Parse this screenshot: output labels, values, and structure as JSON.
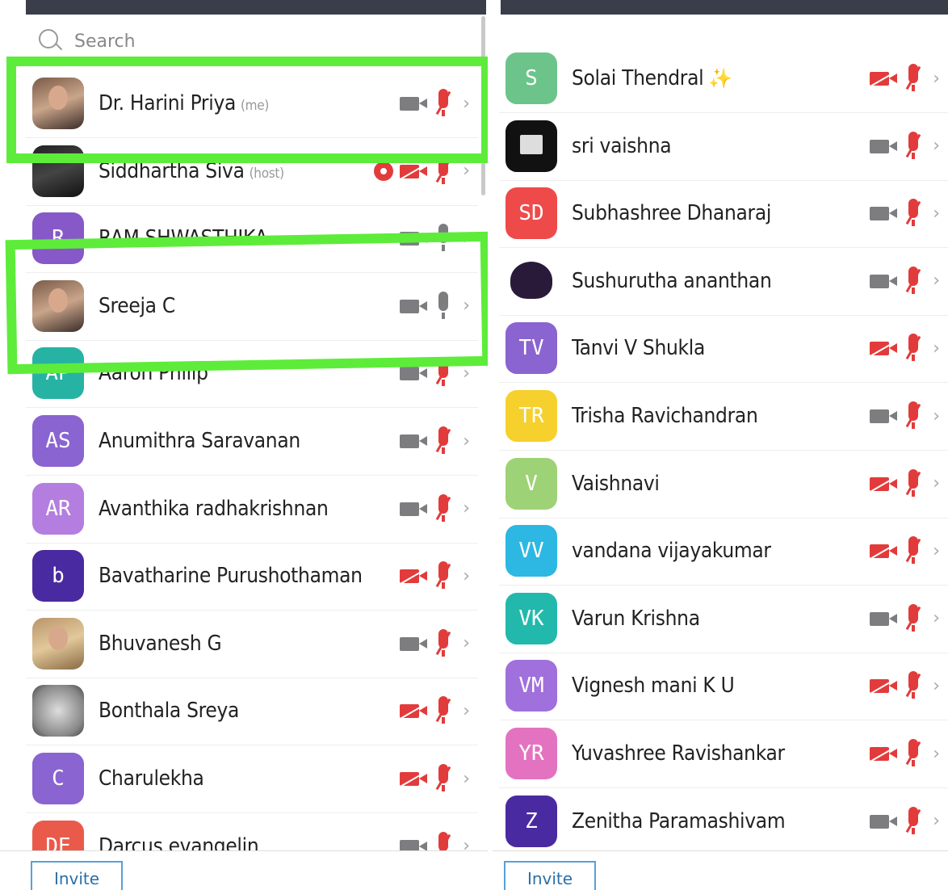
{
  "search": {
    "placeholder": "Search"
  },
  "colors": {
    "highlight": "#5eec3a",
    "muted": "#e23b3b",
    "icon_gray": "#7d7d80"
  },
  "left": [
    {
      "name": "Dr. Harini Priya",
      "tag": "(me)",
      "avatar": "photo",
      "cam": "on",
      "mic": "off"
    },
    {
      "name": "Siddhartha Siva",
      "tag": "(host)",
      "avatar": "photo",
      "cam": "off",
      "mic": "off",
      "rec": true
    },
    {
      "name": "RAM SHWASTHIKA",
      "initials": "R",
      "color": "#8658c8",
      "cam": "on",
      "mic": "on"
    },
    {
      "name": "Sreeja C",
      "avatar": "photo",
      "cam": "on",
      "mic": "on"
    },
    {
      "name": "Aaron Philip",
      "initials": "AP",
      "color": "#27b3a4",
      "cam": "on",
      "mic": "off"
    },
    {
      "name": "Anumithra Saravanan",
      "initials": "AS",
      "color": "#8a64d0",
      "cam": "on",
      "mic": "off"
    },
    {
      "name": "Avanthika radhakrishnan",
      "initials": "AR",
      "color": "#b47ee0",
      "cam": "on",
      "mic": "off"
    },
    {
      "name": "Bavatharine Purushothaman",
      "initials": "b",
      "color": "#4a2aa0",
      "cam": "off",
      "mic": "off"
    },
    {
      "name": "Bhuvanesh G",
      "avatar": "photo",
      "cam": "on",
      "mic": "off"
    },
    {
      "name": "Bonthala Sreya",
      "avatar": "photo",
      "cam": "off",
      "mic": "off"
    },
    {
      "name": "Charulekha",
      "initials": "C",
      "color": "#8a64d0",
      "cam": "off",
      "mic": "off"
    },
    {
      "name": "Darcus evangelin",
      "initials": "DE",
      "color": "#ea5a4a",
      "cam": "on",
      "mic": "off"
    }
  ],
  "right": [
    {
      "name": "Solai Thendral",
      "initials": "S",
      "color": "#6cc48a",
      "cam": "off",
      "mic": "off",
      "sparkle": "✨"
    },
    {
      "name": "sri vaishna",
      "avatar": "photo",
      "cam": "on",
      "mic": "off"
    },
    {
      "name": "Subhashree Dhanaraj",
      "initials": "SD",
      "color": "#ef4a4a",
      "cam": "on",
      "mic": "off"
    },
    {
      "name": "Sushurutha ananthan",
      "avatar": "photo",
      "cam": "on",
      "mic": "off"
    },
    {
      "name": "Tanvi V Shukla",
      "initials": "TV",
      "color": "#8a64d0",
      "cam": "off",
      "mic": "off"
    },
    {
      "name": "Trisha Ravichandran",
      "initials": "TR",
      "color": "#f6d02c",
      "cam": "on",
      "mic": "off"
    },
    {
      "name": "Vaishnavi",
      "initials": "V",
      "color": "#9ed276",
      "cam": "off",
      "mic": "off"
    },
    {
      "name": "vandana vijayakumar",
      "initials": "VV",
      "color": "#2cb8e2",
      "cam": "off",
      "mic": "off"
    },
    {
      "name": "Varun Krishna",
      "initials": "VK",
      "color": "#22b9ac",
      "cam": "on",
      "mic": "off"
    },
    {
      "name": "Vignesh mani K U",
      "initials": "VM",
      "color": "#a070dc",
      "cam": "off",
      "mic": "off"
    },
    {
      "name": "Yuvashree Ravishankar",
      "initials": "YR",
      "color": "#e373c0",
      "cam": "off",
      "mic": "off"
    },
    {
      "name": "Zenitha Paramashivam",
      "initials": "Z",
      "color": "#4a2aa0",
      "cam": "on",
      "mic": "off"
    }
  ],
  "footer": {
    "invite_label": "Invite"
  }
}
